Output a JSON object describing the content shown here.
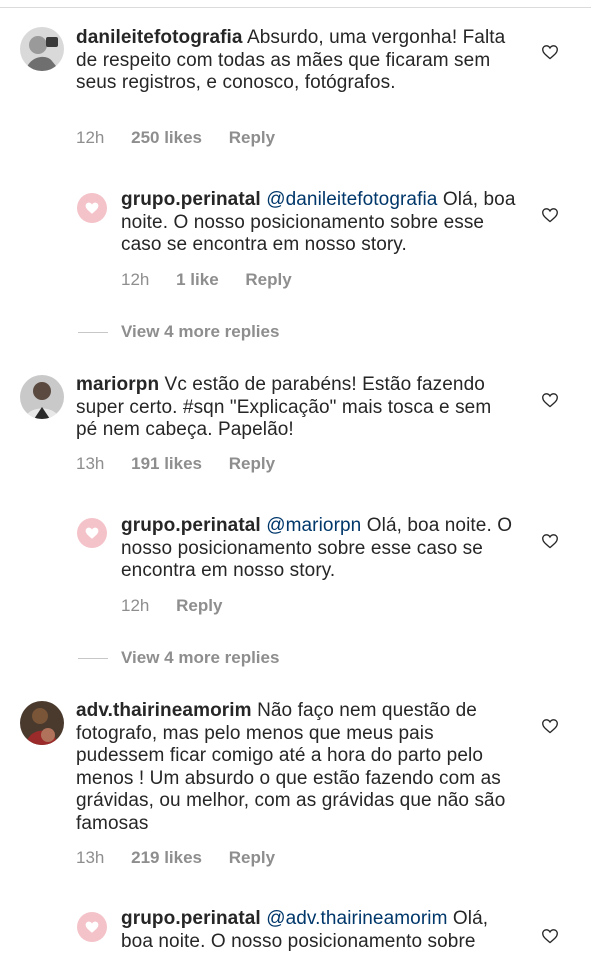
{
  "comments": [
    {
      "username": "danileitefotografia",
      "text": "Absurdo, uma vergonha! Falta de respeito com todas as mães que ficaram sem seus registros, e conosco, fotógrafos.",
      "time": "12h",
      "likes": "250 likes",
      "reply_label": "Reply",
      "avatar_icon": "user-photo-avatar",
      "reply": {
        "username": "grupo.perinatal",
        "mention": "@danileitefotografia",
        "text": "Olá, boa noite. O nosso posicionamento sobre esse caso se encontra em nosso story.",
        "time": "12h",
        "likes": "1 like",
        "reply_label": "Reply"
      },
      "view_more": "View 4 more replies"
    },
    {
      "username": "mariorpn",
      "text": "Vc estão de parabéns! Estão fazendo super certo. #sqn \"Explicação\" mais tosca e sem pé nem cabeça. Papelão!",
      "time": "13h",
      "likes": "191 likes",
      "reply_label": "Reply",
      "avatar_icon": "user-photo-avatar",
      "reply": {
        "username": "grupo.perinatal",
        "mention": "@mariorpn",
        "text": "Olá, boa noite. O nosso posicionamento sobre esse caso se encontra em nosso story.",
        "time": "12h",
        "likes": "",
        "reply_label": "Reply"
      },
      "view_more": "View 4 more replies"
    },
    {
      "username": "adv.thairineamorim",
      "text": "Não faço nem questão de fotografo, mas pelo menos que meus pais pudessem ficar comigo até a hora do parto pelo menos ! Um absurdo o que estão fazendo com as grávidas, ou melhor, com as grávidas que não são famosas",
      "time": "13h",
      "likes": "219 likes",
      "reply_label": "Reply",
      "avatar_icon": "user-photo-avatar",
      "reply": {
        "username": "grupo.perinatal",
        "mention": "@adv.thairineamorim",
        "text": "Olá, boa noite. O nosso posicionamento sobre",
        "time": "",
        "likes": "",
        "reply_label": ""
      }
    }
  ],
  "colors": {
    "text": "#262626",
    "meta": "#8e8e8e",
    "mention": "#00376b",
    "brand_pink": "#f4c3c9"
  },
  "icons": {
    "like": "heart-outline-icon",
    "brand": "perinatal-heart-logo"
  }
}
